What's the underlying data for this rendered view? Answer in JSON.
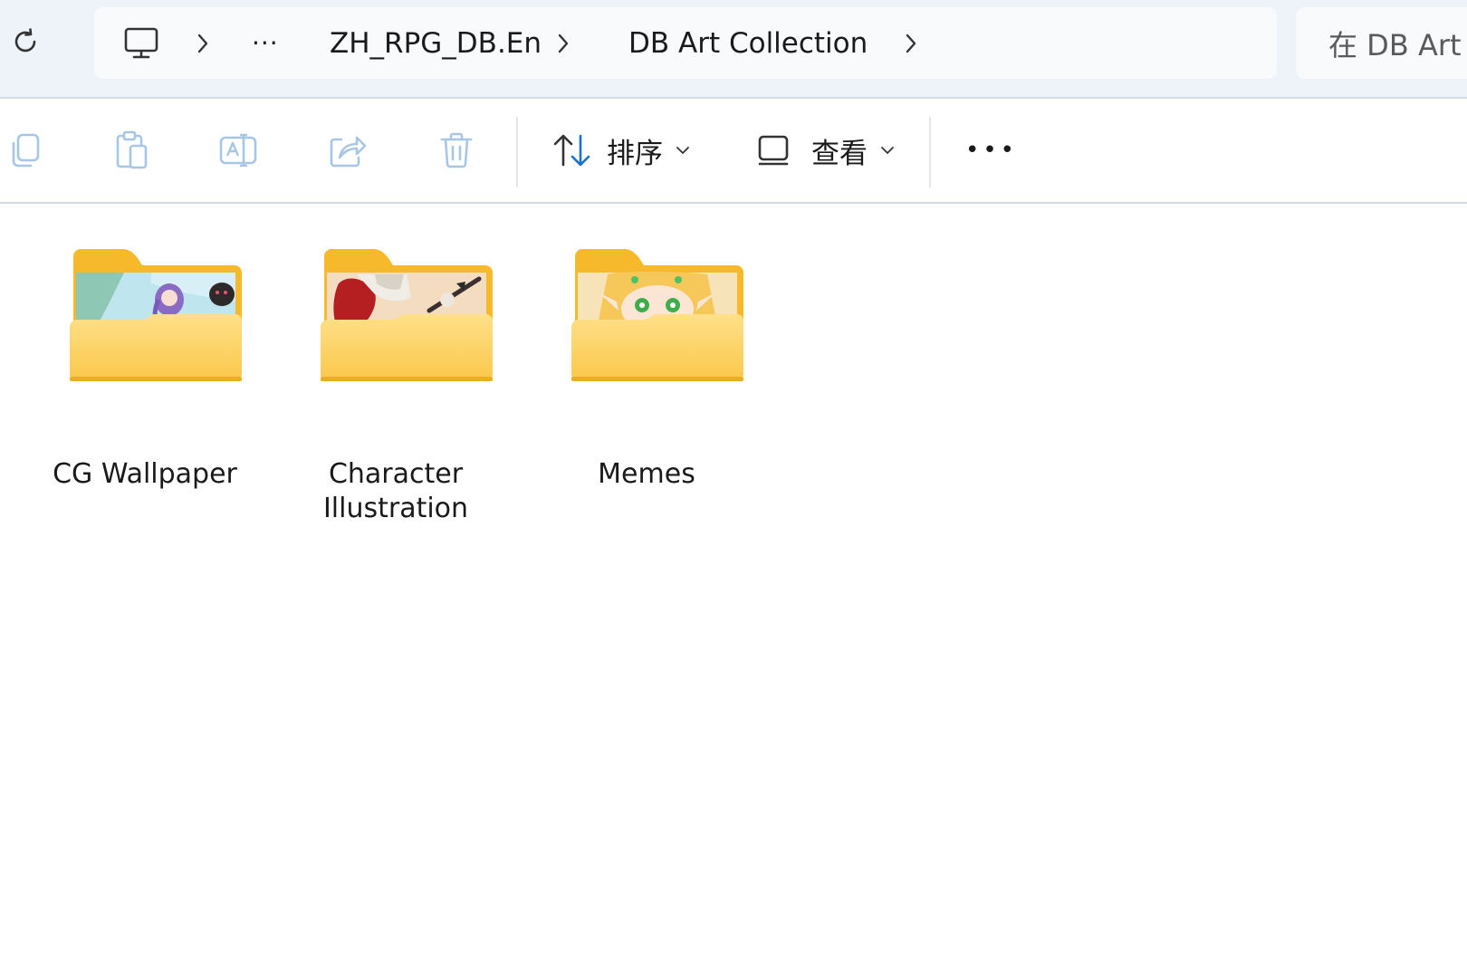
{
  "address_bar": {
    "breadcrumb": {
      "overflow": "···",
      "segments": [
        "ZH_RPG_DB.En",
        "DB Art Collection"
      ]
    },
    "search_placeholder": "在 DB Art"
  },
  "toolbar": {
    "sort_label": "排序",
    "view_label": "查看",
    "more_label": "•••"
  },
  "folders": [
    {
      "name": "CG Wallpaper",
      "preview": "anime-wallpaper-thumbnail"
    },
    {
      "name": "Character Illustration",
      "preview": "character-art-thumbnail"
    },
    {
      "name": "Memes",
      "preview": "meme-thumbnail"
    }
  ],
  "colors": {
    "folder_back": "#f6b92b",
    "folder_front_top": "#ffe089",
    "folder_front_bottom": "#fac84a",
    "sort_arrow_accent": "#1a6fd1",
    "disabled_icon": "#a7c6e6"
  }
}
